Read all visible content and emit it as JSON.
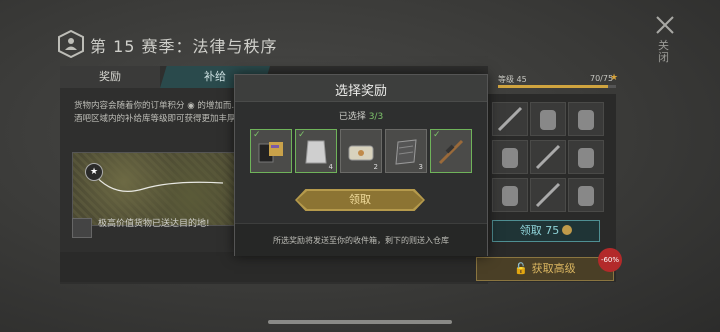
{
  "header": {
    "season_title": "第 15 赛季：法律与秩序",
    "close_label": "关闭"
  },
  "tabs": [
    {
      "label": "奖励"
    },
    {
      "label": "补给"
    }
  ],
  "left": {
    "description": "货物内容会随着你的订单积分 ◉ 的增加而… 酒吧区域内的补给库等级即可获得更加丰厚…",
    "delivery_text": "极高价值货物已送达目的地!"
  },
  "level": {
    "label": "等级 45",
    "value": "70/75",
    "star": "★",
    "progress": 0.933
  },
  "claim": {
    "label": "领取",
    "amount": "75"
  },
  "premium": {
    "label": "获取高级",
    "discount": "-60%"
  },
  "modal": {
    "title": "选择奖励",
    "selected_prefix": "已选择 ",
    "selected_count": "3/3",
    "items": [
      {
        "icon": "document-card-icon",
        "selected": true,
        "qty": ""
      },
      {
        "icon": "foil-bag-icon",
        "selected": true,
        "qty": "4"
      },
      {
        "icon": "bandage-box-icon",
        "selected": false,
        "qty": "2"
      },
      {
        "icon": "metal-plate-icon",
        "selected": false,
        "qty": "3"
      },
      {
        "icon": "sniper-rifle-icon",
        "selected": true,
        "qty": ""
      }
    ],
    "confirm_label": "领取",
    "footer": "所选奖励将发送至你的收件箱，剩下的则送入仓库"
  },
  "colors": {
    "accent_gold": "#b59a4c",
    "accent_teal": "#4f8f93",
    "selected_green": "#7ec36b"
  }
}
